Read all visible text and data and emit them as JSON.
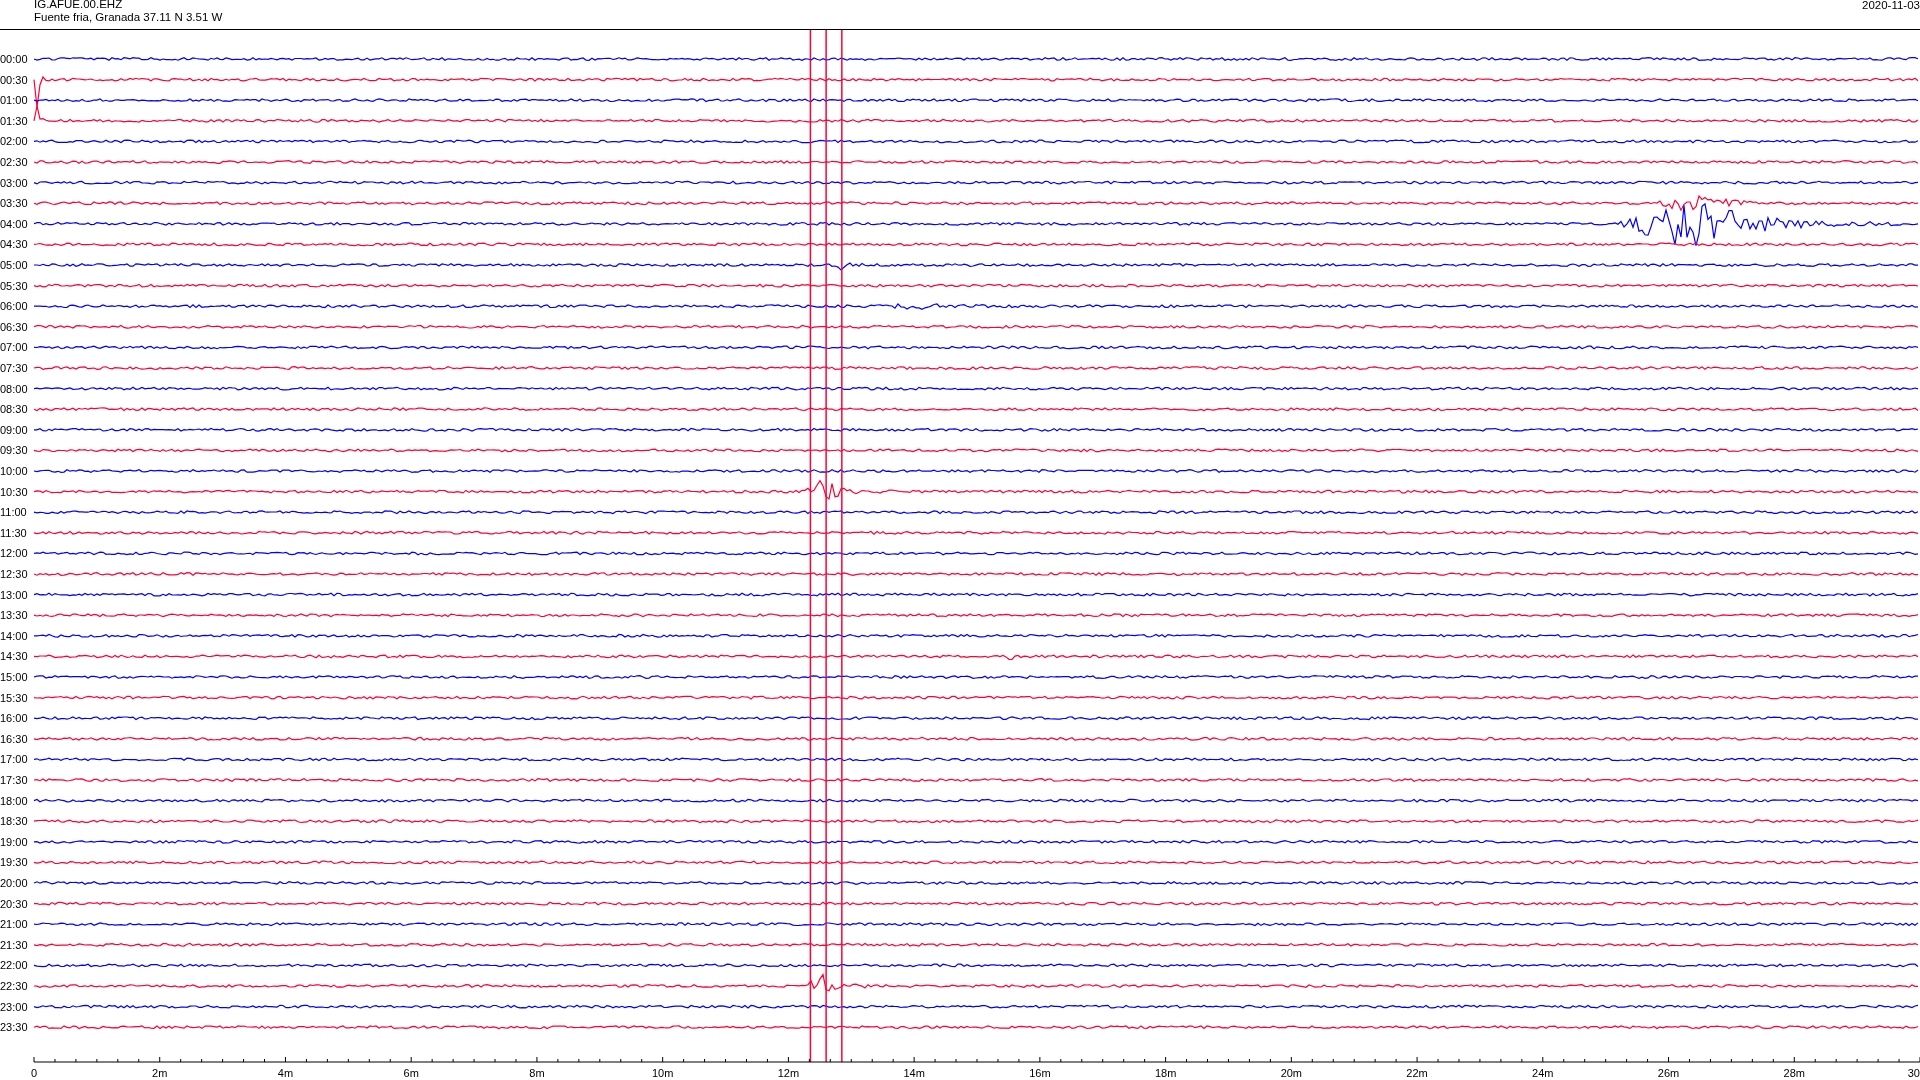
{
  "header": {
    "station": "IG.AFUE.00.EHZ",
    "location": "Fuente fria, Granada  37.11 N 3.51 W",
    "date": "2020-11-03"
  },
  "rows": [
    {
      "time": "00:00",
      "color": "#0000ff"
    },
    {
      "time": "00:30",
      "color": "#ff0033"
    },
    {
      "time": "01:00",
      "color": "#0000ff"
    },
    {
      "time": "01:30",
      "color": "#ff0033"
    },
    {
      "time": "02:00",
      "color": "#0000ff"
    },
    {
      "time": "02:30",
      "color": "#ff0033"
    },
    {
      "time": "03:00",
      "color": "#0000ff"
    },
    {
      "time": "03:30",
      "color": "#ff0033"
    },
    {
      "time": "04:00",
      "color": "#0000ff"
    },
    {
      "time": "04:30",
      "color": "#ff0033"
    },
    {
      "time": "05:00",
      "color": "#0000ff"
    },
    {
      "time": "05:30",
      "color": "#ff0033"
    },
    {
      "time": "06:00",
      "color": "#0000ff"
    },
    {
      "time": "06:30",
      "color": "#ff0033"
    },
    {
      "time": "07:00",
      "color": "#0000ff"
    },
    {
      "time": "07:30",
      "color": "#ff0033"
    },
    {
      "time": "08:00",
      "color": "#0000ff"
    },
    {
      "time": "08:30",
      "color": "#ff0033"
    },
    {
      "time": "09:00",
      "color": "#0000ff"
    },
    {
      "time": "09:30",
      "color": "#ff0033"
    },
    {
      "time": "10:00",
      "color": "#0000ff"
    },
    {
      "time": "10:30",
      "color": "#ff0033"
    },
    {
      "time": "11:00",
      "color": "#0000ff"
    },
    {
      "time": "11:30",
      "color": "#ff0033"
    },
    {
      "time": "12:00",
      "color": "#0000ff"
    },
    {
      "time": "12:30",
      "color": "#ff0033"
    },
    {
      "time": "13:00",
      "color": "#0000ff"
    },
    {
      "time": "13:30",
      "color": "#ff0033"
    },
    {
      "time": "14:00",
      "color": "#0000ff"
    },
    {
      "time": "14:30",
      "color": "#ff0033"
    },
    {
      "time": "15:00",
      "color": "#0000ff"
    },
    {
      "time": "15:30",
      "color": "#ff0033"
    },
    {
      "time": "16:00",
      "color": "#0000ff"
    },
    {
      "time": "16:30",
      "color": "#ff0033"
    },
    {
      "time": "17:00",
      "color": "#0000ff"
    },
    {
      "time": "17:30",
      "color": "#ff0033"
    },
    {
      "time": "18:00",
      "color": "#0000ff"
    },
    {
      "time": "18:30",
      "color": "#ff0033"
    },
    {
      "time": "19:00",
      "color": "#0000ff"
    },
    {
      "time": "19:30",
      "color": "#ff0033"
    },
    {
      "time": "20:00",
      "color": "#0000ff"
    },
    {
      "time": "20:30",
      "color": "#ff0033"
    },
    {
      "time": "21:00",
      "color": "#0000ff"
    },
    {
      "time": "21:30",
      "color": "#ff0033"
    },
    {
      "time": "22:00",
      "color": "#0000ff"
    },
    {
      "time": "22:30",
      "color": "#ff0033"
    },
    {
      "time": "23:00",
      "color": "#0000ff"
    },
    {
      "time": "23:30",
      "color": "#ff0033"
    }
  ],
  "time_axis": {
    "ticks": [
      "0",
      "2m",
      "4m",
      "6m",
      "8m",
      "10m",
      "12m",
      "14m",
      "16m",
      "18m",
      "20m",
      "22m",
      "24m",
      "26m",
      "28m",
      "30"
    ]
  }
}
